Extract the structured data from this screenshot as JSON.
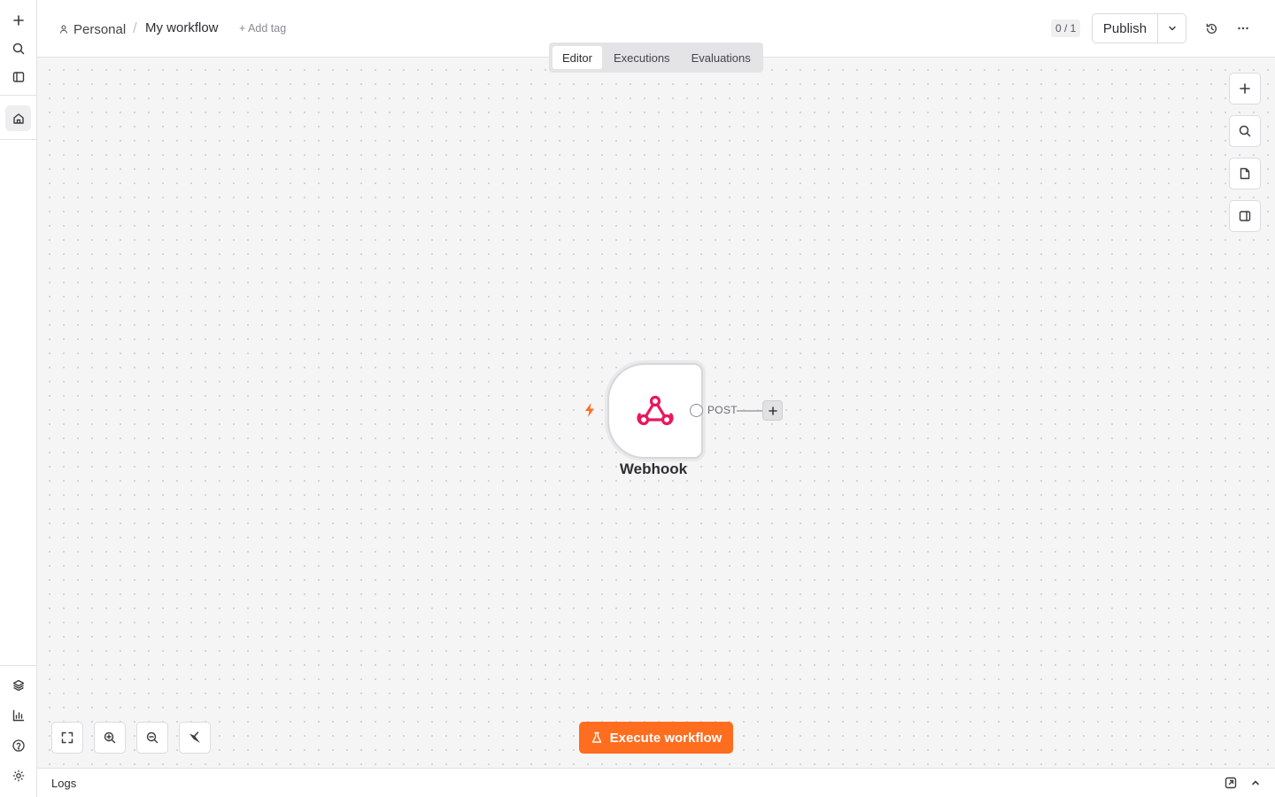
{
  "breadcrumb": {
    "project": "Personal",
    "separator": "/",
    "workflow_name": "My workflow",
    "add_tag": "+ Add tag"
  },
  "header": {
    "counter": "0 / 1",
    "publish_label": "Publish"
  },
  "tabs": [
    {
      "label": "Editor",
      "active": true
    },
    {
      "label": "Executions",
      "active": false
    },
    {
      "label": "Evaluations",
      "active": false
    }
  ],
  "node": {
    "name": "Webhook",
    "output_label": "POST",
    "icon": "webhook-icon",
    "icon_color": "#e8185d",
    "trigger_icon_color": "#ff6d1f"
  },
  "execute_button": {
    "label": "Execute workflow",
    "color": "#ff6d1f"
  },
  "logs": {
    "label": "Logs"
  }
}
